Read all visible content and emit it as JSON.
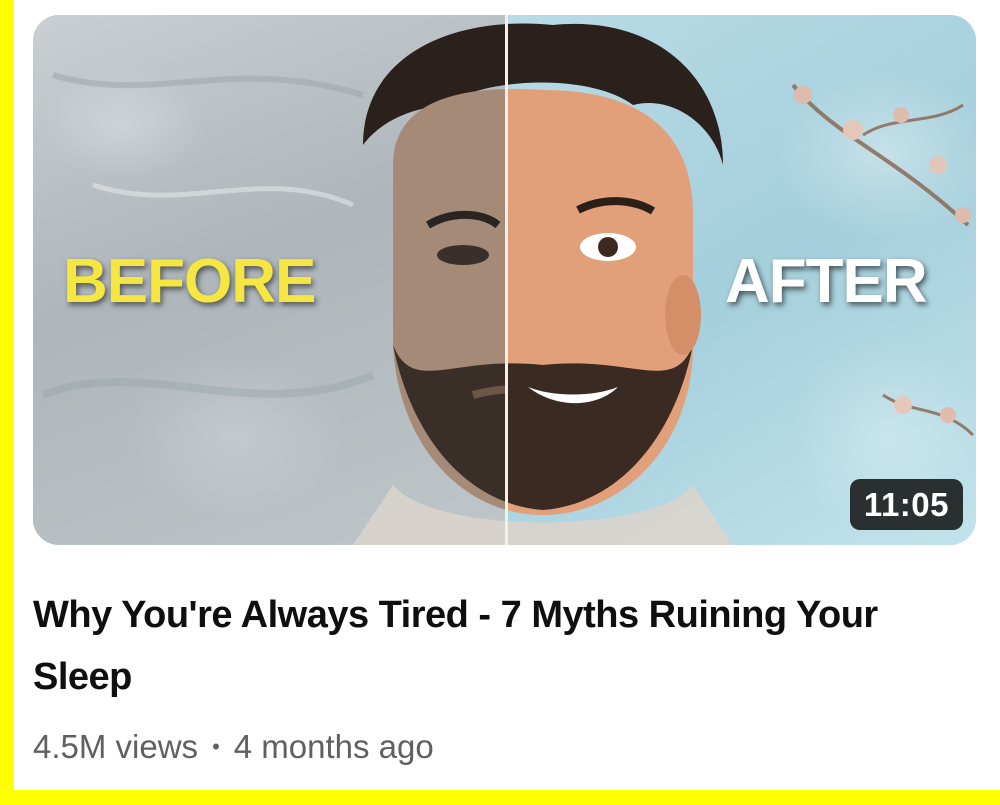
{
  "video": {
    "title": "Why You're Always Tired - 7 Myths Ruining Your Sleep",
    "duration": "11:05",
    "views": "4.5M views",
    "separator": "•",
    "published": "4 months ago",
    "thumbnail": {
      "label_left": "BEFORE",
      "label_right": "AFTER"
    }
  },
  "colors": {
    "frame": "#ffff00",
    "before_label": "#f5e642",
    "after_label": "#ffffff",
    "title_text": "#0f0f0f",
    "meta_text": "#606060",
    "duration_bg": "#0f0f0f"
  }
}
